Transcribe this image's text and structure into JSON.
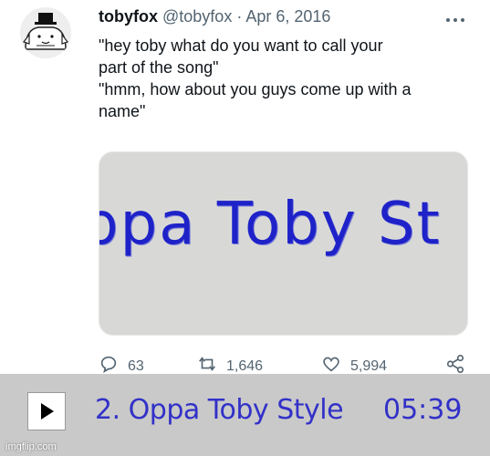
{
  "tweet": {
    "author_name": "tobyfox",
    "handle": "@tobyfox",
    "separator": "·",
    "date": "Apr 6, 2016",
    "lines": [
      "\"hey toby what do you want to call your",
      "part of the song\"",
      "\"hmm, how about you guys come up with a",
      "name\""
    ],
    "media_caption": "ppa Toby St",
    "replies": "63",
    "retweets": "1,646",
    "likes": "5,994",
    "icons": [
      "more-icon",
      "reply-icon",
      "retweet-icon",
      "like-icon",
      "share-icon"
    ]
  },
  "player": {
    "track": "2. Oppa Toby Style",
    "time": "05:39",
    "text_color": "#3231c8"
  },
  "watermark": "imgflip.com"
}
